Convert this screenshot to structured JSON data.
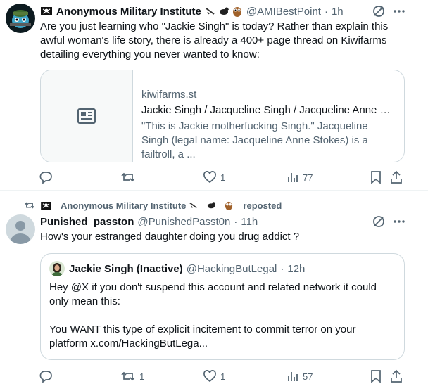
{
  "tweet1": {
    "author_name": "Anonymous Military Institute",
    "author_handle": "@AMIBestPoint",
    "time": "1h",
    "text": "Are you just learning who \"Jackie Singh\" is today? Rather than explain this awful woman's life story, there is already a 400+ page thread on Kiwifarms detailing everything you never wanted to know:",
    "card": {
      "domain": "kiwifarms.st",
      "title": "Jackie Singh / Jacqueline Singh / Jacqueline Anne St...",
      "description": "\"This is Jackie motherfucking Singh.\" Jacqueline Singh (legal name: Jacqueline Anne Stokes) is a failtroll, a ..."
    },
    "actions": {
      "replies": "",
      "reposts": "",
      "likes": "1",
      "views": "77"
    }
  },
  "tweet2": {
    "repost_by": "Anonymous Military Institute",
    "repost_suffix": "reposted",
    "author_name": "Punished_passton",
    "author_handle": "@PunishedPasst0n",
    "time": "11h",
    "text": "How's your estranged daughter doing you drug addict ?",
    "quote": {
      "author_name": "Jackie Singh (Inactive)",
      "author_handle": "@HackingButLegal",
      "time": "12h",
      "text_line1": "Hey @X if you don't suspend this account and related network it could only mean this:",
      "text_line2": "You WANT this type of explicit incitement to commit terror on your platform x.com/HackingButLega..."
    },
    "actions": {
      "replies": "",
      "reposts": "1",
      "likes": "1",
      "views": "57"
    }
  },
  "icons": {
    "reply": "reply-icon",
    "repost": "repost-icon",
    "like": "heart-icon",
    "views": "views-icon",
    "bookmark": "bookmark-icon",
    "share": "share-icon",
    "grok": "grok-icon",
    "more": "more-icon",
    "article": "article-icon"
  },
  "colors": {
    "text": "#0f1419",
    "secondary": "#536471",
    "border": "#cfd9de"
  }
}
